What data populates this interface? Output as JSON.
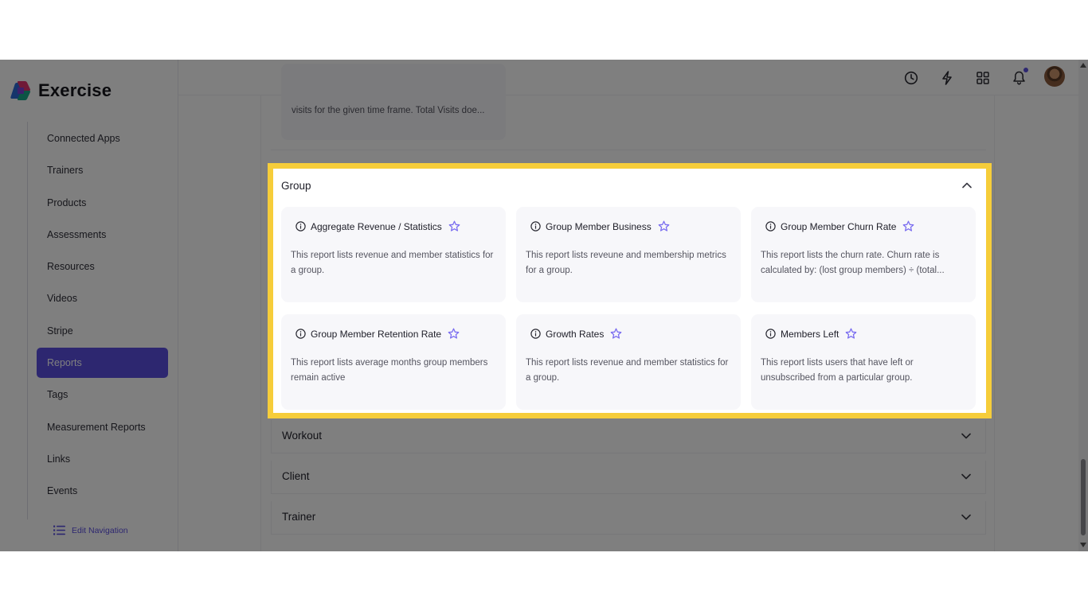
{
  "app": {
    "name": "Exercise",
    "logo_colors": [
      "#e0336e",
      "#2c6bd6",
      "#18a98a",
      "#7b3fd6"
    ]
  },
  "sidebar": {
    "items": [
      {
        "label": "Connected Apps",
        "active": false
      },
      {
        "label": "Trainers",
        "active": false
      },
      {
        "label": "Products",
        "active": false
      },
      {
        "label": "Assessments",
        "active": false
      },
      {
        "label": "Resources",
        "active": false
      },
      {
        "label": "Videos",
        "active": false
      },
      {
        "label": "Stripe",
        "active": false
      },
      {
        "label": "Reports",
        "active": true
      },
      {
        "label": "Tags",
        "active": false
      },
      {
        "label": "Measurement Reports",
        "active": false
      },
      {
        "label": "Links",
        "active": false
      },
      {
        "label": "Events",
        "active": false
      }
    ],
    "edit_nav_label": "Edit Navigation"
  },
  "topbar": {
    "icons": [
      "history-icon",
      "bolt-icon",
      "apps-grid-icon",
      "bell-icon"
    ],
    "has_notification": true
  },
  "previous_section": {
    "card_desc": "visits for the given time frame. Total Visits doe..."
  },
  "group_section": {
    "title": "Group",
    "expanded": true,
    "cards": [
      {
        "title": "Aggregate Revenue / Statistics",
        "desc": "This report lists revenue and member statistics for a group."
      },
      {
        "title": "Group Member Business",
        "desc": "This report lists reveune and membership metrics for a group."
      },
      {
        "title": "Group Member Churn Rate",
        "desc": "This report lists the churn rate. Churn rate is calculated by: (lost group members) ÷ (total..."
      },
      {
        "title": "Group Member Retention Rate",
        "desc": "This report lists average months group members remain active"
      },
      {
        "title": "Growth Rates",
        "desc": "This report lists revenue and member statistics for a group."
      },
      {
        "title": "Members Left",
        "desc": "This report lists users that have left or unsubscribed from a particular group."
      }
    ]
  },
  "collapsed_sections": [
    {
      "title": "Workout"
    },
    {
      "title": "Client"
    },
    {
      "title": "Trainer"
    }
  ],
  "colors": {
    "accent": "#5b4ee0",
    "highlight": "#f6cd3a",
    "star": "#7b6ef0"
  }
}
